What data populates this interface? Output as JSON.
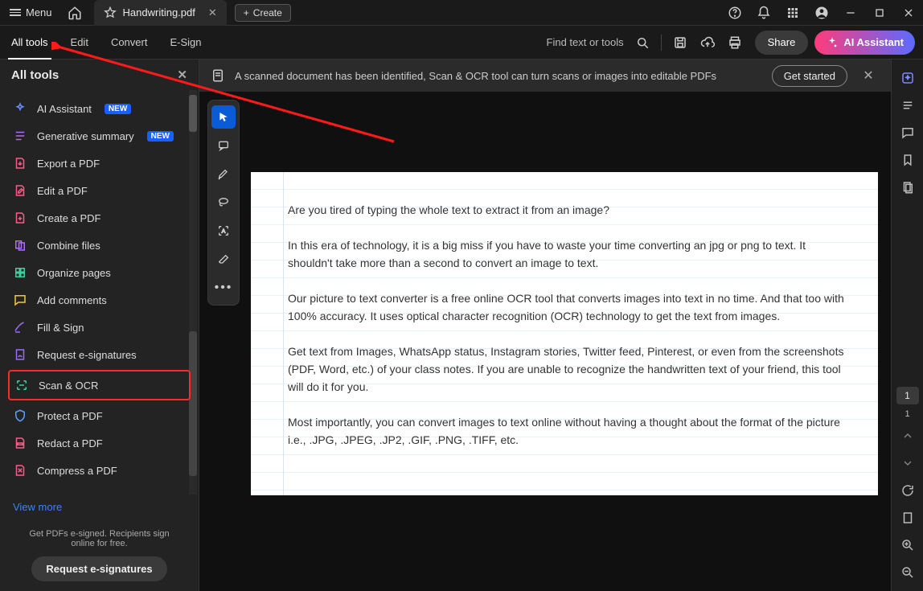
{
  "titlebar": {
    "menu": "Menu",
    "tab_title": "Handwriting.pdf",
    "create": "Create"
  },
  "toolbar": {
    "alltools": "All tools",
    "edit": "Edit",
    "convert": "Convert",
    "esign": "E-Sign",
    "find": "Find text or tools",
    "share": "Share",
    "ai": "AI Assistant"
  },
  "sidebar": {
    "title": "All tools",
    "items": [
      {
        "label": "AI Assistant",
        "badge": "NEW",
        "color": "#6b8bff"
      },
      {
        "label": "Generative summary",
        "badge": "NEW",
        "color": "#b06bff"
      },
      {
        "label": "Export a PDF",
        "color": "#ff5a8a"
      },
      {
        "label": "Edit a PDF",
        "color": "#ff5a8a"
      },
      {
        "label": "Create a PDF",
        "color": "#ff5a8a"
      },
      {
        "label": "Combine files",
        "color": "#b06bff"
      },
      {
        "label": "Organize pages",
        "color": "#3bd19c"
      },
      {
        "label": "Add comments",
        "color": "#f5c542"
      },
      {
        "label": "Fill & Sign",
        "color": "#9a6bff"
      },
      {
        "label": "Request e-signatures",
        "color": "#9a6bff"
      },
      {
        "label": "Scan & OCR",
        "color": "#3bd19c"
      },
      {
        "label": "Protect a PDF",
        "color": "#5aa0ff"
      },
      {
        "label": "Redact a PDF",
        "color": "#ff5a8a"
      },
      {
        "label": "Compress a PDF",
        "color": "#ff5a8a"
      }
    ],
    "viewmore": "View more",
    "footer_l1": "Get PDFs e-signed. Recipients sign",
    "footer_l2": "online for free.",
    "req_btn": "Request e-signatures"
  },
  "banner": {
    "text": "A scanned document has been identified, Scan & OCR tool can turn scans or images into editable PDFs",
    "cta": "Get started"
  },
  "document": {
    "p1": "Are you tired of typing the whole text to extract it from an image?",
    "p2": "In this era of technology, it is a big miss if you have to waste your time converting an jpg or png to text. It shouldn't take more than a second to convert an image to text.",
    "p3": "Our picture to text converter is a free online OCR tool that converts images into text in no time. And that too with 100% accuracy. It uses optical character recognition (OCR) technology to get the text from images.",
    "p4": "Get text from Images, WhatsApp status, Instagram stories, Twitter feed, Pinterest, or even from the screenshots (PDF, Word, etc.) of your class notes. If you are unable to recognize the handwritten text of your friend, this tool will do it for you.",
    "p5": "Most importantly, you can convert images to text online without having a thought about the format of the picture i.e., .JPG, .JPEG, .JP2, .GIF, .PNG, .TIFF, etc."
  },
  "right": {
    "page": "1",
    "total": "1"
  }
}
